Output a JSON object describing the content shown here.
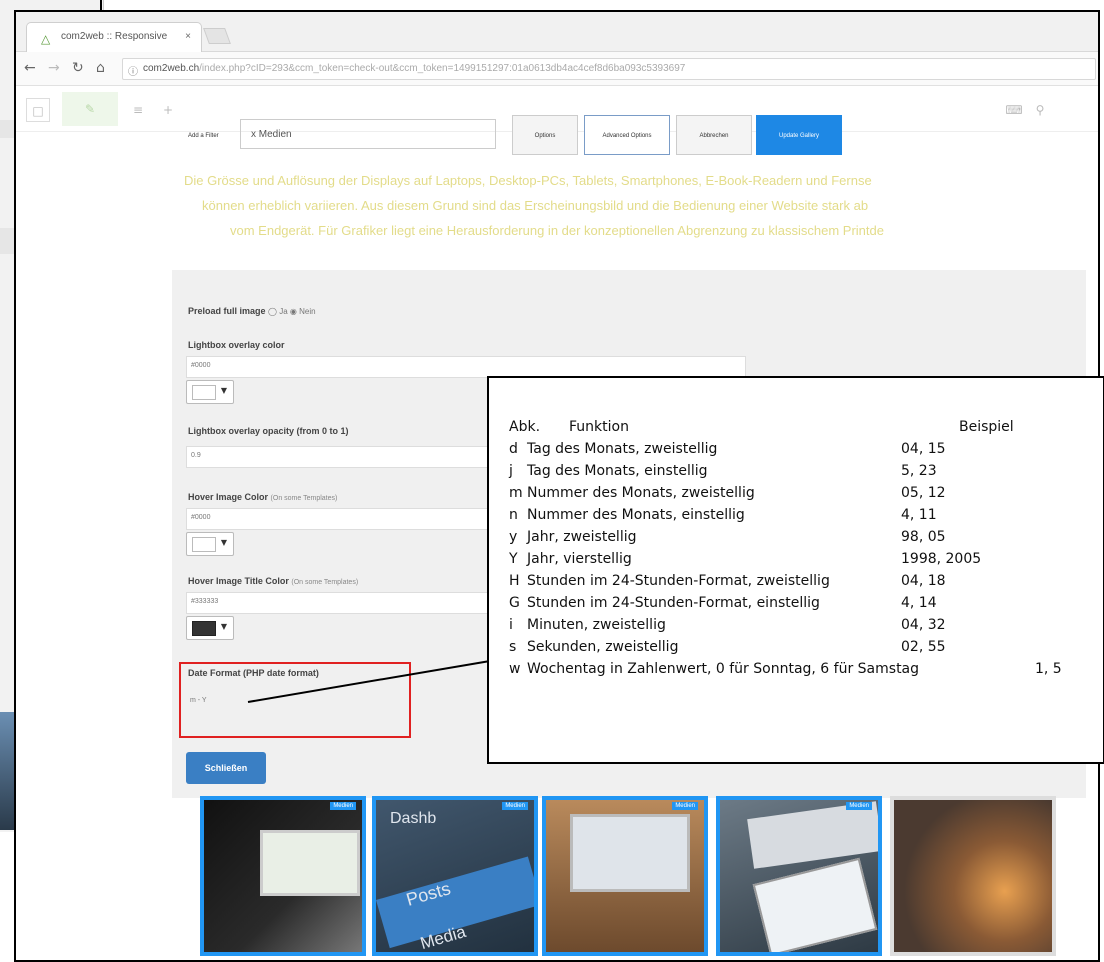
{
  "browser": {
    "tab_title": "com2web :: Responsive",
    "tab_close": "×",
    "url_host": "com2web.ch",
    "url_path": "/index.php?cID=293&ccm_token=check-out&ccm_token=1499151297:01a0613db4ac4cef8d6ba093c5393697"
  },
  "editor": {
    "filter_label": "Add a Filter",
    "filter_value": "x Medien",
    "buttons": [
      "Options",
      "Advanced Options",
      "Abbrechen",
      "Update Gallery"
    ]
  },
  "description": [
    "Die Grösse und Auflösung der Displays auf Laptops, Desktop-PCs, Tablets, Smartphones, E-Book-Readern und Fernse",
    "können erheblich variieren. Aus diesem Grund sind das Erscheinungsbild und die Bedienung einer Website stark ab",
    "vom Endgerät. Für Grafiker liegt eine Herausforderung in der konzeptionellen Abgrenzung zu klassischem Printde"
  ],
  "settings": {
    "preload_label": "Preload full image",
    "preload_options": "◯ Ja ◉ Nein",
    "overlay_color_label": "Lightbox overlay color",
    "overlay_color_value": "#0000",
    "overlay_opacity_label": "Lightbox overlay opacity (from 0 to 1)",
    "overlay_opacity_value": "0.9",
    "hover_color_label": "Hover Image Color",
    "hover_color_hint": "(On some Templates)",
    "hover_color_value": "#0000",
    "hover_title_label": "Hover Image Title Color",
    "hover_title_hint": "(On some Templates)",
    "hover_title_value": "#333333",
    "date_format_label": "Date Format (PHP date format)",
    "date_format_value": "m - Y",
    "close_button": "Schließen"
  },
  "thumbnails": {
    "badge": "Medien",
    "t2_words": [
      "Dashb",
      "Posts",
      "Media"
    ]
  },
  "format_table": {
    "header": {
      "abk": "Abk.",
      "funktion": "Funktion",
      "beispiel": "Beispiel"
    },
    "rows": [
      {
        "key": "d",
        "func": "Tag des Monats, zweistellig",
        "example": "04, 15"
      },
      {
        "key": "j",
        "func": "Tag des Monats, einstellig",
        "example": "5, 23"
      },
      {
        "key": "m",
        "func": "Nummer des Monats, zweistellig",
        "example": "05, 12"
      },
      {
        "key": "n",
        "func": "Nummer des Monats, einstellig",
        "example": "4, 11"
      },
      {
        "key": "y",
        "func": "Jahr, zweistellig",
        "example": "98, 05"
      },
      {
        "key": "Y",
        "func": "Jahr, vierstellig",
        "example": "1998, 2005"
      },
      {
        "key": "H",
        "func": "Stunden im 24-Stunden-Format, zweistellig",
        "example": "04, 18"
      },
      {
        "key": "G",
        "func": "Stunden im 24-Stunden-Format, einstellig",
        "example": "4, 14"
      },
      {
        "key": "i",
        "func": "Minuten, zweistellig",
        "example": "04, 32"
      },
      {
        "key": "s",
        "func": "Sekunden, zweistellig",
        "example": "02, 55"
      },
      {
        "key": "w",
        "func": "Wochentag in Zahlenwert, 0 für Sonntag, 6 für Samstag",
        "example": "1, 5"
      }
    ]
  },
  "colors": {
    "accent_blue": "#2196f3",
    "annotation_red": "#e02020",
    "description_text": "#e3dc8a"
  }
}
